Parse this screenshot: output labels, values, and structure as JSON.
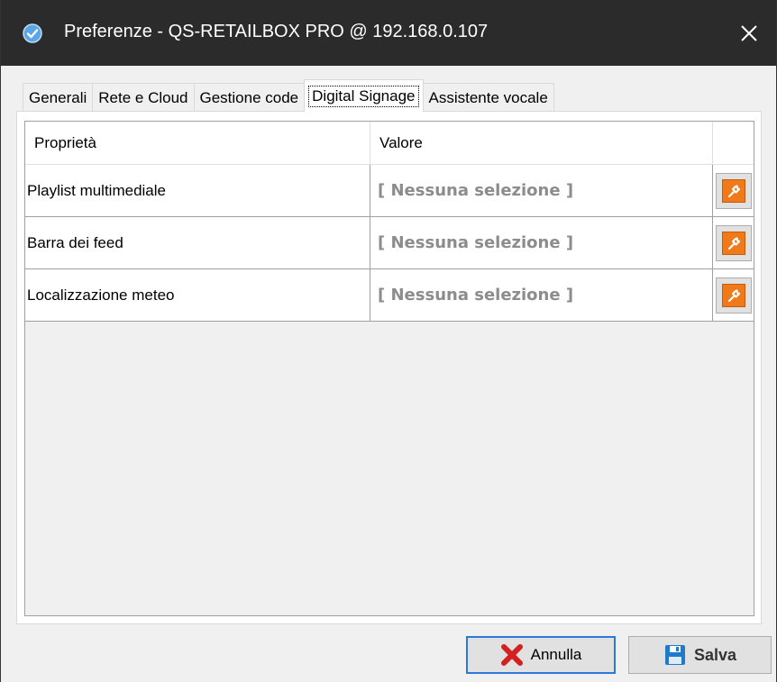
{
  "window": {
    "title": "Preferenze - QS-RETAILBOX PRO @ 192.168.0.107",
    "app_icon": "app-check-icon",
    "close_icon": "close-icon"
  },
  "tabs": [
    {
      "label": "Generali",
      "active": false
    },
    {
      "label": "Rete e Cloud",
      "active": false
    },
    {
      "label": "Gestione code",
      "active": false
    },
    {
      "label": "Digital Signage",
      "active": true
    },
    {
      "label": "Assistente vocale",
      "active": false
    }
  ],
  "grid": {
    "headers": {
      "property": "Proprietà",
      "value": "Valore",
      "action": ""
    },
    "rows": [
      {
        "property": "Playlist multimediale",
        "value": "[ Nessuna selezione ]",
        "icon": "wrench-icon"
      },
      {
        "property": "Barra dei feed",
        "value": "[ Nessuna selezione ]",
        "icon": "wrench-icon"
      },
      {
        "property": "Localizzazione meteo",
        "value": "[ Nessuna selezione ]",
        "icon": "wrench-icon"
      }
    ]
  },
  "buttons": {
    "cancel": {
      "label": "Annulla",
      "icon": "red-x-icon"
    },
    "save": {
      "label": "Salva",
      "icon": "floppy-disk-icon"
    }
  },
  "colors": {
    "titlebar": "#2b2b2b",
    "accent_orange": "#f07a1a",
    "cancel_red": "#d32020",
    "save_blue": "#1f7ac9",
    "focus_border": "#2b7bd6"
  }
}
